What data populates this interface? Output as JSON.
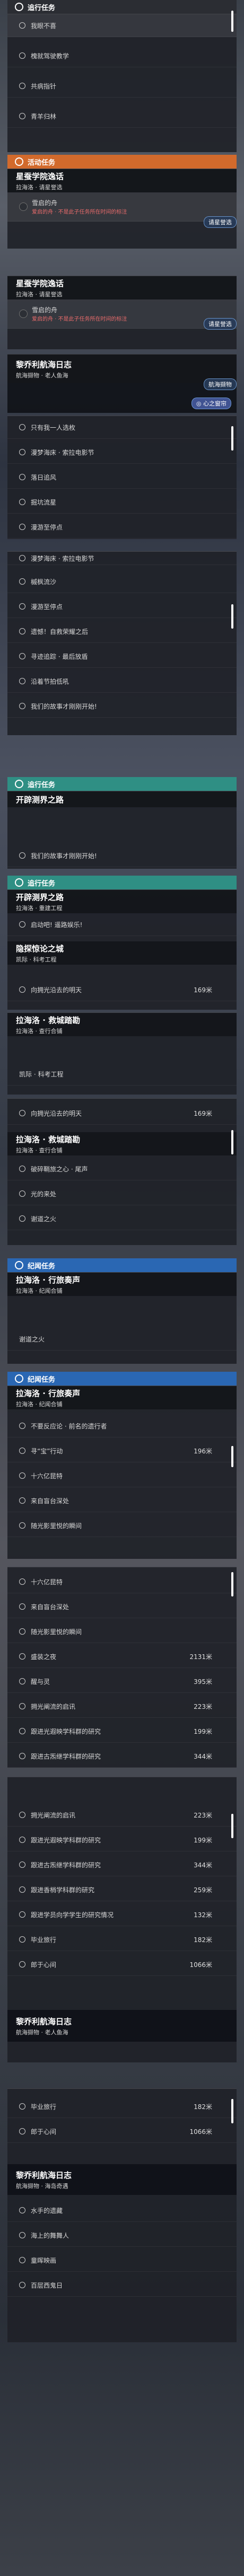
{
  "panel1": {
    "header": "追行任务",
    "rows": [
      "我眼不喜",
      "槐就驾驶教学",
      "共病指针",
      "青羊归林"
    ]
  },
  "panel2": {
    "header": "活动任务",
    "title": "星蚕学院逸话",
    "subtitle": "拉海洛 · 请星誉选",
    "tag": "雪启的舟",
    "warn": "爱启的舟 · 不是此子任务所在时间的标注",
    "badge": "请星誉选"
  },
  "panel3": {
    "title": "星蚕学院逸话",
    "subtitle": "拉海洛 · 请星誉选",
    "tag": "雪启的舟",
    "warn": "爱启的舟 · 不是此子任务所在时间的标注",
    "badge": "请星誉选"
  },
  "panel4": {
    "title": "黎乔利航海日志",
    "subtitle": "航海撷物 · 老人鱼海",
    "badge": "航海撷物",
    "tip": "◎ 心之窗帘"
  },
  "panel5": {
    "rows": [
      "只有我一人选枚",
      "漫梦海床 · 索拉电影节",
      "落日追风",
      "掘坑流星",
      "漫游至停点"
    ]
  },
  "panel6": {
    "rows": [
      "漫梦海床 · 索拉电影节",
      "槭枫流沙",
      "漫游至停点",
      "遗憾！自救荣耀之后",
      "寻迹追踪 · 最后放盾",
      "沿着节拍低吼",
      "我们的故事才刚刚开始!"
    ]
  },
  "panel7": {
    "cat": "追行任务",
    "title": "开辟测界之路",
    "rows": [
      "我们的故事才刚刚开始!"
    ]
  },
  "panel8": {
    "cat": "追行任务",
    "title": "开辟测界之路",
    "subtitle": "拉海洛 · 重建工程",
    "rows": [
      "启动吧! 遥路娱乐!"
    ],
    "title2": "隐探惊论之城",
    "subtitle2": "凯际 · 科考工程",
    "rows2": [
      {
        "label": "向拥光沿去的明天",
        "dist": "169米"
      }
    ]
  },
  "panel9": {
    "title": "拉海洛 · 救城踏勘",
    "subtitle": "拉海洛 · 查行合铺",
    "rows": [
      "凯际 · 科考工程"
    ]
  },
  "panel10": {
    "rows": [
      {
        "label": "向拥光沿去的明天",
        "dist": "169米"
      }
    ],
    "title": "拉海洛 · 救城踏勘",
    "subtitle": "拉海洛 · 查行合铺",
    "rows2": [
      "破碎鞘旅之心 · 尾声",
      "光的来处",
      "谢道之火"
    ]
  },
  "panel11": {
    "cat": "纪闻任务",
    "title": "拉海洛 · 行旅奏声",
    "subtitle": "拉海洛 · 纪闻合铺",
    "rows": [
      "谢道之火"
    ]
  },
  "panel12": {
    "cat": "纪闻任务",
    "title": "拉海洛 · 行旅奏声",
    "subtitle": "拉海洛 · 纪闻合铺",
    "rows": [
      {
        "label": "不要反应论 · 前名的遗行者",
        "dist": ""
      },
      {
        "label": "寻“宝”行动",
        "dist": "196米"
      },
      {
        "label": "十六亿昆特",
        "dist": ""
      },
      {
        "label": "来自盲台深处",
        "dist": ""
      },
      {
        "label": "随光影里悦的瞬间",
        "dist": ""
      }
    ]
  },
  "panel13": {
    "rows": [
      {
        "label": "十六亿昆特",
        "dist": ""
      },
      {
        "label": "来自盲台深处",
        "dist": ""
      },
      {
        "label": "随光影里悦的瞬间",
        "dist": ""
      },
      {
        "label": "盛装之夜",
        "dist": "2131米"
      },
      {
        "label": "醒与灵",
        "dist": "395米"
      },
      {
        "label": "拥光阐流的启讯",
        "dist": "223米"
      },
      {
        "label": "跟进光遐映学科群的研究",
        "dist": "199米"
      },
      {
        "label": "跟进古炁继学科群的研究",
        "dist": "344米"
      }
    ]
  },
  "panel14": {
    "rows": [
      {
        "label": "拥光阐流的启讯",
        "dist": "223米"
      },
      {
        "label": "跟进光遐映学科群的研究",
        "dist": "199米"
      },
      {
        "label": "跟进古炁继学科群的研究",
        "dist": "344米"
      },
      {
        "label": "跟进香梢学科群的研究",
        "dist": "259米"
      },
      {
        "label": "跟进学员向学学生的研究情况",
        "dist": "132米"
      },
      {
        "label": "毕业旅行",
        "dist": "182米"
      },
      {
        "label": "郎于心间",
        "dist": "1066米"
      }
    ],
    "title": "黎乔利航海日志",
    "subtitle": "航海撷物 · 老人鱼海"
  },
  "panel15": {
    "rows": [
      {
        "label": "毕业旅行",
        "dist": "182米"
      },
      {
        "label": "郎于心间",
        "dist": "1066米"
      }
    ],
    "title": "黎乔利航海日志",
    "subtitle": "航海撷物 · 海岛奇遇",
    "rows2": [
      "水手的遗藏",
      "海上的舞舞人",
      "童晖映画",
      "百层西鬼日"
    ]
  }
}
